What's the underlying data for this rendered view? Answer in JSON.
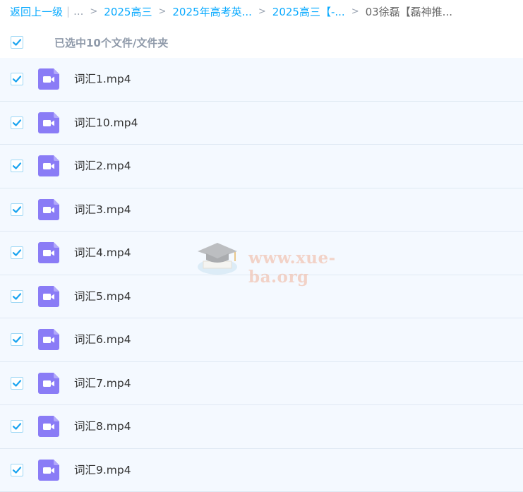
{
  "breadcrumb": {
    "back_label": "返回上一级",
    "ellipsis": "...",
    "items": [
      "2025高三",
      "2025年高考英...",
      "2025高三【-...",
      "03徐磊【磊神推..."
    ]
  },
  "selection": {
    "label": "已选中10个文件/文件夹",
    "all_checked": true
  },
  "files": [
    {
      "name": "词汇1.mp4",
      "checked": true,
      "icon": "video-file-icon"
    },
    {
      "name": "词汇10.mp4",
      "checked": true,
      "icon": "video-file-icon"
    },
    {
      "name": "词汇2.mp4",
      "checked": true,
      "icon": "video-file-icon"
    },
    {
      "name": "词汇3.mp4",
      "checked": true,
      "icon": "video-file-icon"
    },
    {
      "name": "词汇4.mp4",
      "checked": true,
      "icon": "video-file-icon"
    },
    {
      "name": "词汇5.mp4",
      "checked": true,
      "icon": "video-file-icon"
    },
    {
      "name": "词汇6.mp4",
      "checked": true,
      "icon": "video-file-icon"
    },
    {
      "name": "词汇7.mp4",
      "checked": true,
      "icon": "video-file-icon"
    },
    {
      "name": "词汇8.mp4",
      "checked": true,
      "icon": "video-file-icon"
    },
    {
      "name": "词汇9.mp4",
      "checked": true,
      "icon": "video-file-icon"
    }
  ],
  "watermark": {
    "text": "www.xue-ba.org"
  },
  "colors": {
    "accent": "#09aaff",
    "row_bg": "#f4f9ff",
    "video_icon": "#8a7cf6",
    "check": "#1aa4f0"
  }
}
